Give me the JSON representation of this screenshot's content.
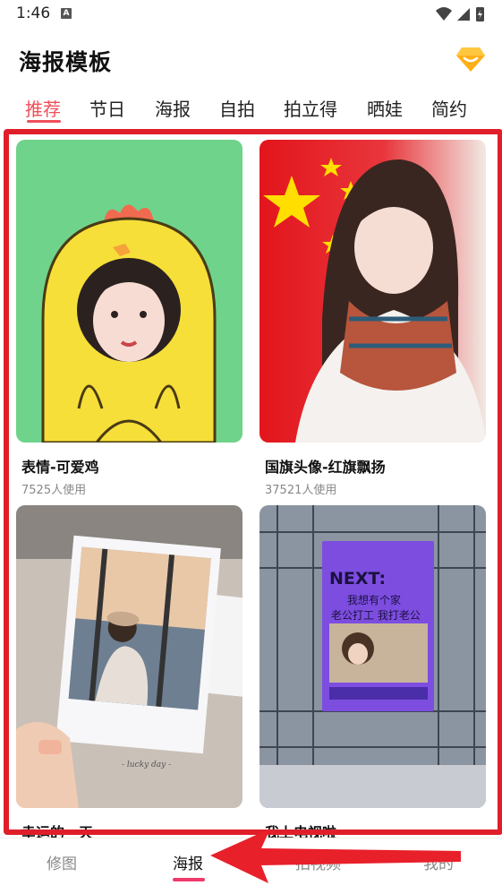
{
  "status": {
    "time": "1:46",
    "notif_letter": "A"
  },
  "header": {
    "title": "海报模板",
    "vip_icon": "diamond-vip-icon"
  },
  "tabs": [
    {
      "label": "推荐",
      "active": true
    },
    {
      "label": "节日"
    },
    {
      "label": "海报"
    },
    {
      "label": "自拍"
    },
    {
      "label": "拍立得"
    },
    {
      "label": "晒娃"
    },
    {
      "label": "简约"
    }
  ],
  "cards": [
    {
      "title": "表情-可爱鸡",
      "usage": "7525人使用"
    },
    {
      "title": "国旗头像-红旗飘扬",
      "usage": "37521人使用"
    },
    {
      "title": "幸运的一天",
      "usage": ""
    },
    {
      "title": "我上电视啦",
      "usage": ""
    }
  ],
  "card3_caption": "- lucky day -",
  "card4": {
    "screen_title": "NEXT:",
    "line1": "我想有个家",
    "line2": "老公打工 我打老公"
  },
  "bottom_nav": [
    {
      "label": "修图"
    },
    {
      "label": "海报",
      "active": true
    },
    {
      "label": "拍视频"
    },
    {
      "label": "我的"
    }
  ],
  "colors": {
    "accent": "#ef4f5a",
    "frame": "#e01e2a",
    "annotation_arrow": "#e8202a"
  }
}
